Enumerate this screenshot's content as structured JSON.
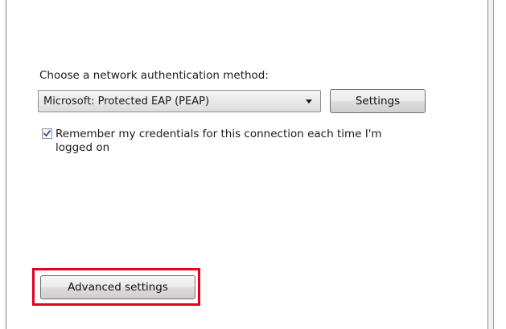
{
  "auth": {
    "label": "Choose a network authentication method:",
    "selected_method": "Microsoft: Protected EAP (PEAP)",
    "settings_label": "Settings"
  },
  "remember": {
    "checked": true,
    "label": "Remember my credentials for this connection each time I'm logged on"
  },
  "advanced": {
    "label": "Advanced settings"
  },
  "colors": {
    "highlight": "#e3001b",
    "checkmark": "#3a5ea8"
  }
}
